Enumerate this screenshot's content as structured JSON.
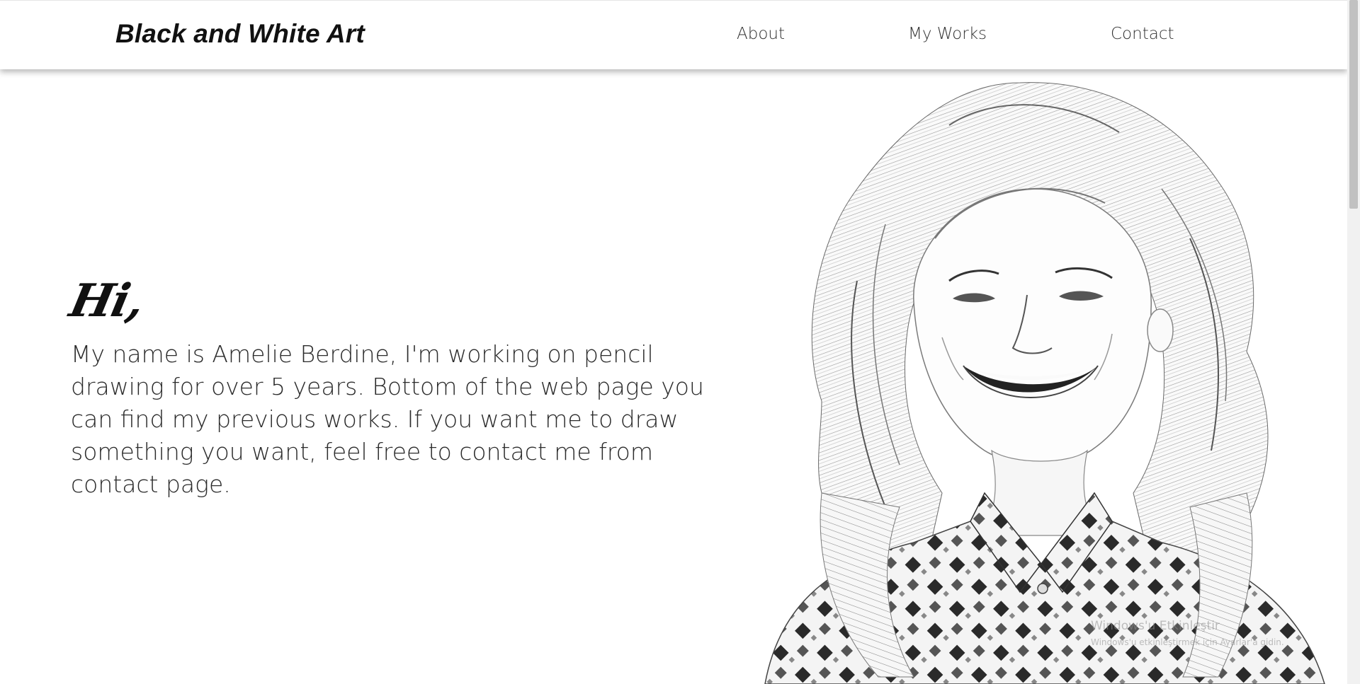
{
  "header": {
    "brand": "Black and White Art",
    "nav": {
      "about": "About",
      "my_works": "My Works",
      "contact": "Contact"
    }
  },
  "hero": {
    "greeting": "Hi,",
    "intro": "My name is Amelie Berdine, I'm working on pencil drawing for over 5 years. Bottom of the web page you can find my previous works. If you want me to draw something you want, feel free to contact me from contact page."
  },
  "watermark": {
    "title": "Windows'u Etkinleştir",
    "subtitle": "Windows'u etkinleştirmek için Ayarlar'a gidin."
  },
  "colors": {
    "text": "#2b2b2b",
    "heading": "#111111",
    "background": "#ffffff"
  }
}
